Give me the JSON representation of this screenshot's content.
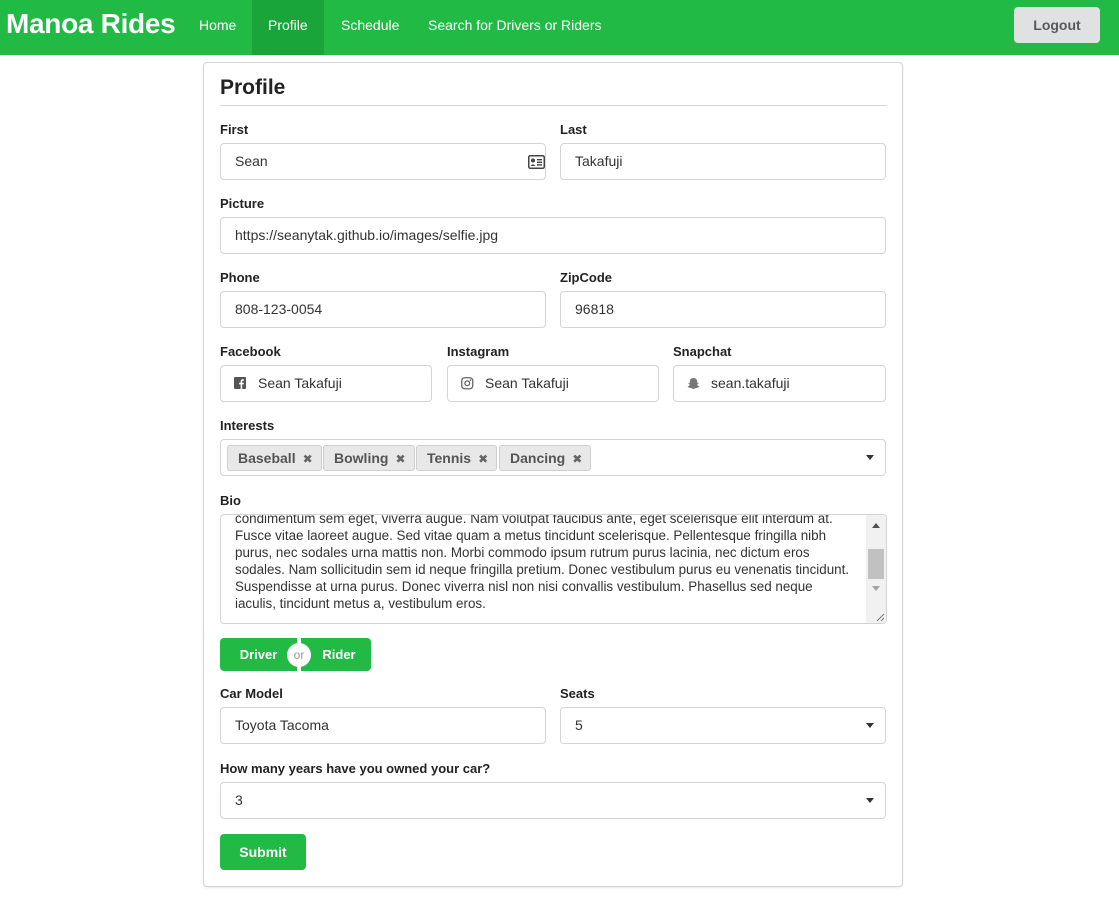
{
  "nav": {
    "brand": "Manoa Rides",
    "items": [
      "Home",
      "Profile",
      "Schedule",
      "Search for Drivers or Riders"
    ],
    "logout": "Logout"
  },
  "form": {
    "title": "Profile",
    "first": {
      "label": "First",
      "value": "Sean",
      "icon": "id-card-icon"
    },
    "last": {
      "label": "Last",
      "value": "Takafuji"
    },
    "picture": {
      "label": "Picture",
      "value": "https://seanytak.github.io/images/selfie.jpg"
    },
    "phone": {
      "label": "Phone",
      "value": "808-123-0054"
    },
    "zip": {
      "label": "ZipCode",
      "value": "96818"
    },
    "facebook": {
      "label": "Facebook",
      "value": "Sean Takafuji",
      "icon": "facebook-icon"
    },
    "instagram": {
      "label": "Instagram",
      "value": "Sean Takafuji",
      "icon": "instagram-icon"
    },
    "snapchat": {
      "label": "Snapchat",
      "value": "sean.takafuji",
      "icon": "snapchat-icon"
    },
    "interests": {
      "label": "Interests",
      "tags": [
        "Baseball",
        "Bowling",
        "Tennis",
        "Dancing"
      ],
      "remove_glyph": "✖"
    },
    "bio": {
      "label": "Bio",
      "value": "condimentum sem eget, viverra augue. Nam volutpat faucibus ante, eget scelerisque elit interdum at. Fusce vitae laoreet augue. Sed vitae quam a metus tincidunt scelerisque. Pellentesque fringilla nibh purus, nec sodales urna mattis non. Morbi commodo ipsum rutrum purus lacinia, nec dictum eros sodales. Nam sollicitudin sem id neque fringilla pretium. Donec vestibulum purus eu venenatis tincidunt. Suspendisse at urna purus. Donec viverra nisl non nisi convallis vestibulum. Phasellus sed neque iaculis, tincidunt metus a, vestibulum eros."
    },
    "role": {
      "driver": "Driver",
      "or": "or",
      "rider": "Rider"
    },
    "car_model": {
      "label": "Car Model",
      "value": "Toyota Tacoma"
    },
    "seats": {
      "label": "Seats",
      "value": "5"
    },
    "years": {
      "label": "How many years have you owned your car?",
      "value": "3"
    },
    "submit": "Submit"
  },
  "colors": {
    "brand_green": "#21ba45",
    "nav_active": "#1aa53b",
    "logout_bg": "#e0e1e2"
  }
}
